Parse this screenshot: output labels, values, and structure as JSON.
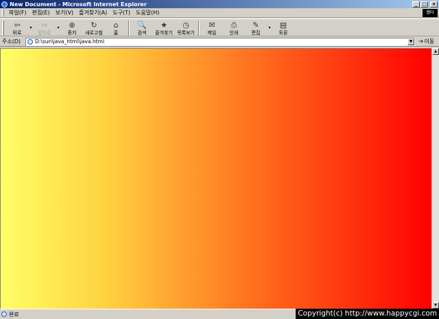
{
  "window": {
    "title": "New Document - Microsoft Internet Explorer",
    "min_glyph": "_",
    "max_glyph": "□",
    "close_glyph": "×"
  },
  "menu": {
    "items": [
      "파일(F)",
      "편집(E)",
      "보기(V)",
      "즐겨찾기(A)",
      "도구(T)",
      "도움말(H)"
    ],
    "brand_label": "웹터"
  },
  "toolbar": {
    "back": {
      "label": "뒤로",
      "icon": "back-arrow-icon",
      "glyph": "⇦"
    },
    "forward": {
      "label": "앞으로",
      "icon": "forward-arrow-icon",
      "glyph": "⇨"
    },
    "stop": {
      "label": "중지",
      "icon": "stop-icon",
      "glyph": "⊗"
    },
    "refresh": {
      "label": "새로고침",
      "icon": "refresh-icon",
      "glyph": "↻"
    },
    "home": {
      "label": "홈",
      "icon": "home-icon",
      "glyph": "⌂"
    },
    "search": {
      "label": "검색",
      "icon": "search-icon",
      "glyph": "🔍"
    },
    "favorites": {
      "label": "즐겨찾기",
      "icon": "favorites-icon",
      "glyph": "★"
    },
    "history": {
      "label": "목록보기",
      "icon": "history-icon",
      "glyph": "◷"
    },
    "mail": {
      "label": "메일",
      "icon": "mail-icon",
      "glyph": "✉"
    },
    "print": {
      "label": "인쇄",
      "icon": "print-icon",
      "glyph": "⎙"
    },
    "edit": {
      "label": "편집",
      "icon": "edit-icon",
      "glyph": "✎"
    },
    "discuss": {
      "label": "토론",
      "icon": "discuss-icon",
      "glyph": "▤"
    },
    "dropdown_glyph": "▾"
  },
  "address": {
    "label": "주소(D)",
    "value": "D:\\sun\\java_html\\java.html",
    "go_label": "이동",
    "go_glyph": "➜",
    "drop_glyph": "▼"
  },
  "scrollbar": {
    "up_glyph": "▲",
    "down_glyph": "▼"
  },
  "status": {
    "text": "완료",
    "copyright": "Copyright(c) http://www.happycgi.com"
  },
  "colors": {
    "gradient_start": "#ffff66",
    "gradient_mid": "#ff7a22",
    "gradient_end": "#ff0000",
    "titlebar": "#0a246a"
  }
}
